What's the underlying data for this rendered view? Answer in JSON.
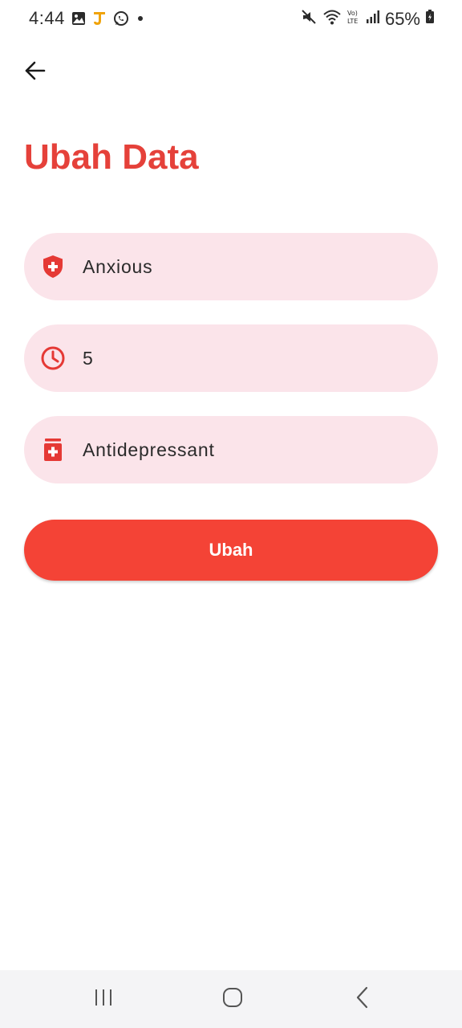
{
  "status_bar": {
    "time": "4:44",
    "battery": "65%",
    "icons_left": [
      "gallery-icon",
      "app-j-icon",
      "whatsapp-icon",
      "dot-icon"
    ],
    "icons_right": [
      "mute-icon",
      "wifi-icon",
      "volte-icon",
      "signal-icon",
      "battery-icon"
    ]
  },
  "header": {
    "back_icon": "arrow-left-icon"
  },
  "page": {
    "title": "Ubah Data"
  },
  "form": {
    "fields": [
      {
        "icon": "shield-plus-icon",
        "value": "Anxious"
      },
      {
        "icon": "clock-icon",
        "value": "5"
      },
      {
        "icon": "medicine-bottle-icon",
        "value": "Antidepressant"
      }
    ],
    "submit_label": "Ubah"
  },
  "nav_bar": {
    "buttons": [
      "recents-icon",
      "home-icon",
      "back-chevron-icon"
    ]
  },
  "colors": {
    "accent": "#e5413a",
    "button": "#f44336",
    "field_bg": "#fbe4ea",
    "icon": "#e53935"
  }
}
